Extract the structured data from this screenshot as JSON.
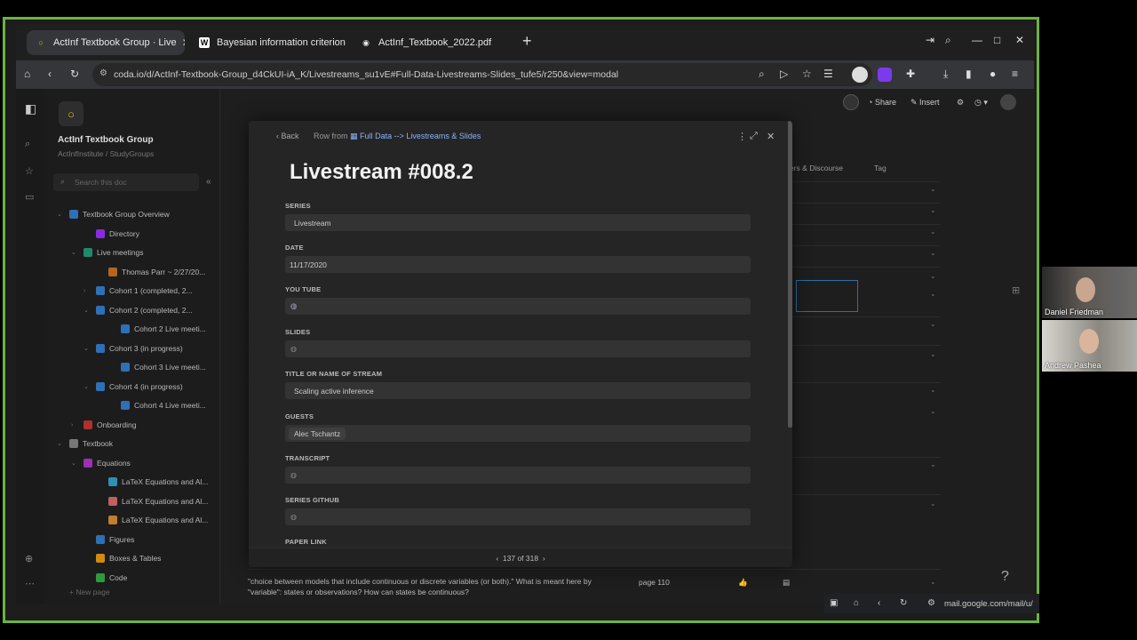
{
  "tabs": [
    {
      "title": "ActInf Textbook Group · Live",
      "active": true
    },
    {
      "title": "Bayesian information criterion",
      "active": false
    },
    {
      "title": "ActInf_Textbook_2022.pdf",
      "active": false
    }
  ],
  "url": "coda.io/d/ActInf-Textbook-Group_d4CkUI-iA_K/Livestreams_su1vE#Full-Data-Livestreams-Slides_tufe5/r250&view=modal",
  "doc": {
    "title": "ActInf Textbook Group",
    "subtitle": "ActInfInstitute / StudyGroups",
    "search_placeholder": "Search this doc",
    "new_page": "New page"
  },
  "tree": [
    {
      "label": "Textbook Group Overview",
      "color": "#2f6fb5"
    },
    {
      "label": "Directory",
      "color": "#8a2be2"
    },
    {
      "label": "Live meetings",
      "color": "#1f8a6a"
    },
    {
      "label": "Thomas Parr ~ 2/27/20...",
      "color": "#b5651d"
    },
    {
      "label": "Cohort 1 (completed, 2...",
      "color": "#2f6fb5"
    },
    {
      "label": "Cohort 2 (completed, 2...",
      "color": "#2f6fb5"
    },
    {
      "label": "Cohort 2 Live meeti...",
      "color": "#2f6fb5"
    },
    {
      "label": "Cohort 3 (in progress)",
      "color": "#2f6fb5"
    },
    {
      "label": "Cohort 3 Live meeti...",
      "color": "#2f6fb5"
    },
    {
      "label": "Cohort 4 (in progress)",
      "color": "#2f6fb5"
    },
    {
      "label": "Cohort 4 Live meeti...",
      "color": "#2f6fb5"
    },
    {
      "label": "Onboarding",
      "color": "#b03030"
    },
    {
      "label": "Textbook",
      "color": "#777777"
    },
    {
      "label": "Equations",
      "color": "#9b30b0"
    },
    {
      "label": "LaTeX Equations and Al...",
      "color": "#2f8fb5"
    },
    {
      "label": "LaTeX Equations and Al...",
      "color": "#c06060"
    },
    {
      "label": "LaTeX Equations and Al...",
      "color": "#c08030"
    },
    {
      "label": "Figures",
      "color": "#2f6fb5"
    },
    {
      "label": "Boxes & Tables",
      "color": "#d08a10"
    },
    {
      "label": "Code",
      "color": "#2f9a3a"
    }
  ],
  "doc_toolbar": {
    "share": "Share",
    "insert": "Insert"
  },
  "bg_columns": {
    "col1": "ers & Discourse",
    "col2": "Tag"
  },
  "bottom_row": {
    "text": "\"choice between models that include continuous or discrete variables (or both).\" What is meant here by \"variable\": states or observations? How can states be continuous?",
    "page": "page 110"
  },
  "modal": {
    "back": "Back",
    "row_from": "Row from",
    "row_table": "Full Data --> Livestreams & Slides",
    "title": "Livestream #008.2",
    "fields": [
      {
        "label": "SERIES",
        "value": "Livestream"
      },
      {
        "label": "DATE",
        "value": "11/17/2020"
      },
      {
        "label": "YOU TUBE",
        "value": ""
      },
      {
        "label": "SLIDES",
        "value": ""
      },
      {
        "label": "TITLE OR NAME OF STREAM",
        "value": "Scaling active inference"
      },
      {
        "label": "GUESTS",
        "value": "Alec Tschantz"
      },
      {
        "label": "TRANSCRIPT",
        "value": ""
      },
      {
        "label": "SERIES GITHUB",
        "value": ""
      },
      {
        "label": "PAPER LINK",
        "value": ""
      }
    ],
    "pager": "137 of 318"
  },
  "participants": [
    {
      "name": "Daniel Friedman"
    },
    {
      "name": "Andrew Pashea"
    }
  ],
  "strip_url": "mail.google.com/mail/u/"
}
